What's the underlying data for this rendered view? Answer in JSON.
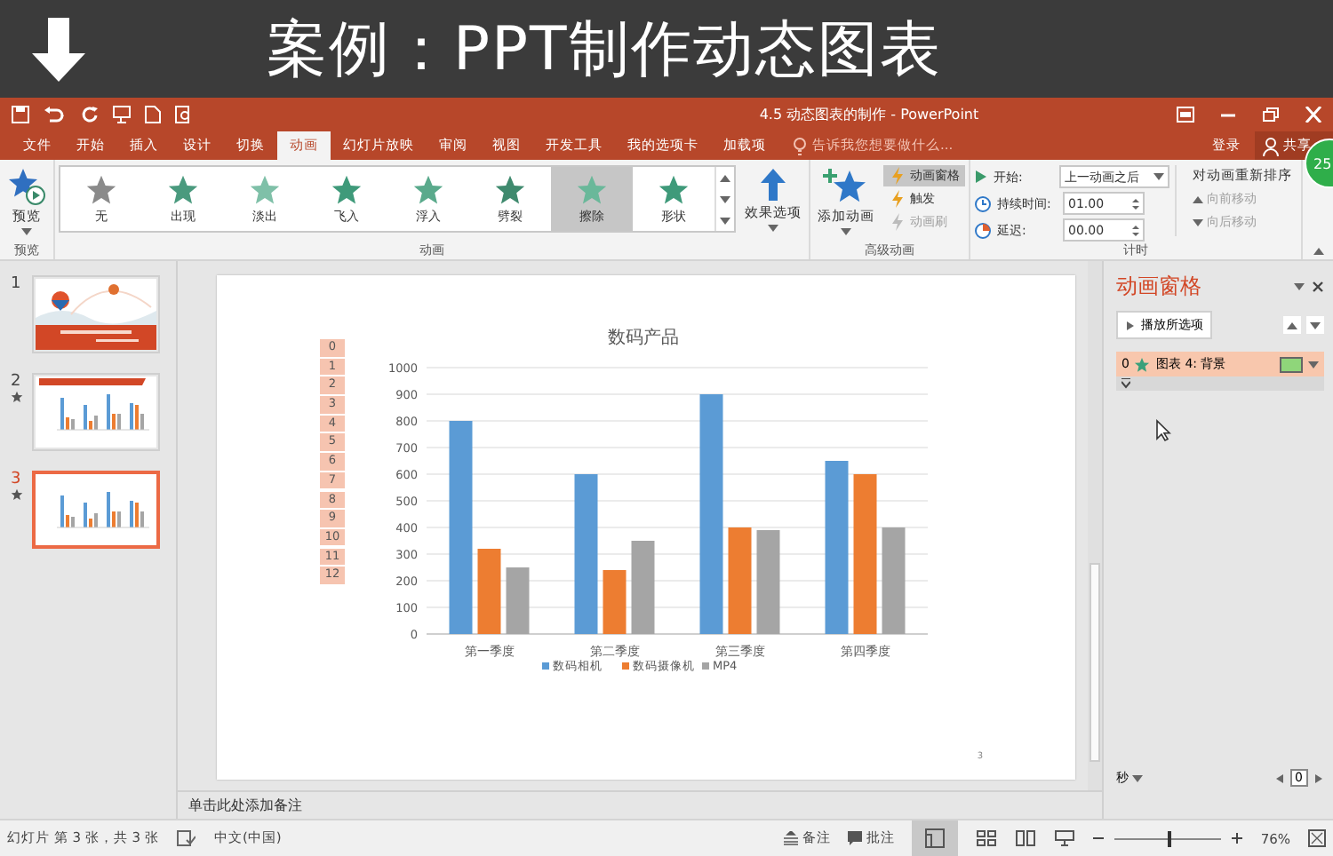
{
  "banner": {
    "title": "案例：PPT制作动态图表"
  },
  "window": {
    "title": "4.5 动态图表的制作 - PowerPoint"
  },
  "tabs": [
    {
      "label": "文件",
      "selected": false
    },
    {
      "label": "开始",
      "selected": false
    },
    {
      "label": "插入",
      "selected": false
    },
    {
      "label": "设计",
      "selected": false
    },
    {
      "label": "切换",
      "selected": false
    },
    {
      "label": "动画",
      "selected": true
    },
    {
      "label": "幻灯片放映",
      "selected": false
    },
    {
      "label": "审阅",
      "selected": false
    },
    {
      "label": "视图",
      "selected": false
    },
    {
      "label": "开发工具",
      "selected": false
    },
    {
      "label": "我的选项卡",
      "selected": false
    },
    {
      "label": "加载项",
      "selected": false
    }
  ],
  "tell_me": {
    "placeholder": "告诉我您想要做什么..."
  },
  "account": {
    "sign_in": "登录",
    "share": "共享",
    "badge": "25"
  },
  "ribbon": {
    "preview": {
      "label": "预览",
      "group": "预览"
    },
    "gallery": {
      "group": "动画",
      "items": [
        {
          "label": "无",
          "color": "#8a8a8a",
          "selected": false
        },
        {
          "label": "出现",
          "color": "#4a9a7e",
          "selected": false
        },
        {
          "label": "淡出",
          "color": "#7fc0a8",
          "selected": false
        },
        {
          "label": "飞入",
          "color": "#3f9a7a",
          "selected": false
        },
        {
          "label": "浮入",
          "color": "#5aaa8c",
          "selected": false
        },
        {
          "label": "劈裂",
          "color": "#3f8a6e",
          "selected": false
        },
        {
          "label": "擦除",
          "color": "#6ab89a",
          "selected": true
        },
        {
          "label": "形状",
          "color": "#3f9a7a",
          "selected": false
        }
      ]
    },
    "effect_options": "效果选项",
    "advanced": {
      "group": "高级动画",
      "add": "添加动画",
      "items": [
        {
          "label": "动画窗格",
          "selected": true,
          "disabled": false
        },
        {
          "label": "触发",
          "selected": false,
          "disabled": false
        },
        {
          "label": "动画刷",
          "selected": false,
          "disabled": true
        }
      ]
    },
    "timing": {
      "group": "计时",
      "start_label": "开始:",
      "start_value": "上一动画之后",
      "duration_label": "持续时间:",
      "duration_value": "01.00",
      "delay_label": "延迟:",
      "delay_value": "00.00",
      "reorder": "对动画重新排序",
      "moves": [
        {
          "label": "向前移动",
          "disabled": true
        },
        {
          "label": "向后移动",
          "disabled": true
        }
      ]
    }
  },
  "slides": [
    {
      "number": "1",
      "animated": false,
      "selected": false,
      "kind": "title"
    },
    {
      "number": "2",
      "animated": true,
      "selected": false,
      "kind": "chart"
    },
    {
      "number": "3",
      "animated": true,
      "selected": true,
      "kind": "chart"
    }
  ],
  "slide": {
    "tags": [
      "0",
      "1",
      "2",
      "3",
      "4",
      "5",
      "6",
      "7",
      "8",
      "9",
      "10",
      "11",
      "12"
    ],
    "page_number": "3",
    "chart_data": {
      "type": "bar",
      "title": "数码产品",
      "categories": [
        "第一季度",
        "第二季度",
        "第三季度",
        "第四季度"
      ],
      "series": [
        {
          "name": "数码相机",
          "color": "#5b9bd5",
          "values": [
            800,
            600,
            900,
            650
          ]
        },
        {
          "name": "数码摄像机",
          "color": "#ed7d31",
          "values": [
            320,
            240,
            400,
            600
          ]
        },
        {
          "name": "MP4",
          "color": "#a5a5a5",
          "values": [
            250,
            350,
            390,
            400
          ]
        }
      ],
      "ylim": [
        0,
        1000
      ],
      "grid": true,
      "legend": "bottom",
      "yticks": [
        0,
        100,
        200,
        300,
        400,
        500,
        600,
        700,
        800,
        900,
        1000
      ]
    }
  },
  "notes": {
    "placeholder": "单击此处添加备注"
  },
  "animation_pane": {
    "title": "动画窗格",
    "play": "播放所选项",
    "items": [
      {
        "order": "0",
        "label": "图表 4: 背景",
        "selected": true
      }
    ],
    "unit": "秒",
    "time": "0"
  },
  "status_bar": {
    "slide_info": "幻灯片 第 3 张，共 3 张",
    "language": "中文(中国)",
    "notes": "备注",
    "comments": "批注",
    "zoom": "76%",
    "level": 0.5
  }
}
